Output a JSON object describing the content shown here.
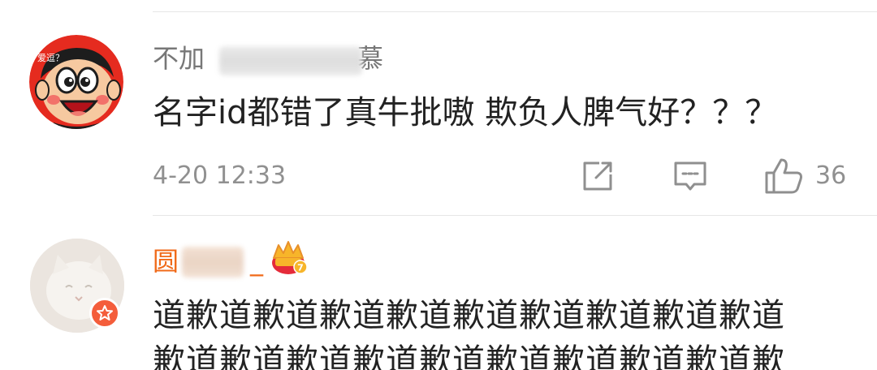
{
  "comments": [
    {
      "username_visible_prefix": "不加",
      "username_visible_suffix": "慕",
      "text": "名字id都错了真牛批嗷 欺负人脾气好？？？",
      "timestamp": "4-20 12:33",
      "like_count": "36",
      "avatar_caption": "爱逗？"
    },
    {
      "username_visible_prefix": "圆",
      "username_visible_suffix": "_",
      "text_line1": "道歉道歉道歉道歉道歉道歉道歉道歉道歉道",
      "text_line2": "歉道歉道歉道歉道歉道歉道歉道歉道歉道歉",
      "crown_level": "7"
    }
  ],
  "colors": {
    "username_default": "#777777",
    "username_vip": "#f06a19",
    "verified_badge": "#f45d3b"
  }
}
